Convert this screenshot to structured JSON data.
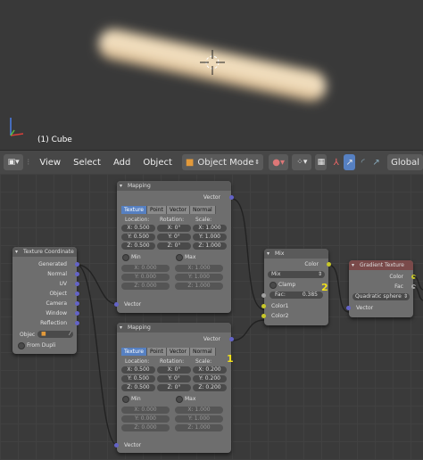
{
  "viewport": {
    "object_label": "(1) Cube"
  },
  "header": {
    "menus": [
      "View",
      "Select",
      "Add",
      "Object"
    ],
    "mode": "Object Mode",
    "orientation": "Global",
    "icons": [
      "editor-type-icon",
      "viewport-shading-icon",
      "pivot-icon",
      "layers-icon",
      "manipulator-icon",
      "translate-icon",
      "rotate-icon",
      "scale-icon"
    ]
  },
  "nodes": {
    "mapping1": {
      "title": "Mapping",
      "output": "Vector",
      "tabs": [
        "Texture",
        "Point",
        "Vector",
        "Normal"
      ],
      "columns": [
        "Location:",
        "Rotation:",
        "Scale:"
      ],
      "rows": [
        [
          "X: 0.500",
          "X: 0°",
          "X: 1.000"
        ],
        [
          "Y: 0.500",
          "Y: 0°",
          "Y: 1.000"
        ],
        [
          "Z: 0.500",
          "Z: 0°",
          "Z: 1.000"
        ]
      ],
      "min_label": "Min",
      "max_label": "Max",
      "min": [
        "X: 0.000",
        "Y: 0.000",
        "Z: 0.000"
      ],
      "max": [
        "X: 1.000",
        "Y: 1.000",
        "Z: 1.000"
      ],
      "input": "Vector"
    },
    "mapping2": {
      "title": "Mapping",
      "output": "Vector",
      "tabs": [
        "Texture",
        "Point",
        "Vector",
        "Normal"
      ],
      "columns": [
        "Location:",
        "Rotation:",
        "Scale:"
      ],
      "rows": [
        [
          "X: 0.500",
          "X: 0°",
          "X: 0.200"
        ],
        [
          "Y: 0.500",
          "Y: 0°",
          "Y: 0.200"
        ],
        [
          "Z: 0.500",
          "Z: 0°",
          "Z: 0.200"
        ]
      ],
      "min_label": "Min",
      "max_label": "Max",
      "min": [
        "X: 0.000",
        "Y: 0.000",
        "Z: 0.000"
      ],
      "max": [
        "X: 1.000",
        "Y: 1.000",
        "Z: 1.000"
      ],
      "input": "Vector"
    },
    "texcoord": {
      "title": "Texture Coordinate",
      "outputs": [
        "Generated",
        "Normal",
        "UV",
        "Object",
        "Camera",
        "Window",
        "Reflection"
      ],
      "object_label": "Objec",
      "from_dupli": "From Dupli"
    },
    "mix": {
      "title": "Mix",
      "output": "Color",
      "blend": "Mix",
      "clamp": "Clamp",
      "fac_label": "Fac:",
      "fac_value": "0.385",
      "inputs": [
        "Color1",
        "Color2"
      ]
    },
    "gradient": {
      "title": "Gradient Texture",
      "outputs": [
        "Color",
        "Fac"
      ],
      "type": "Quadratic sphere",
      "input": "Vector"
    }
  },
  "annotations": {
    "one": "1",
    "two": "2"
  }
}
